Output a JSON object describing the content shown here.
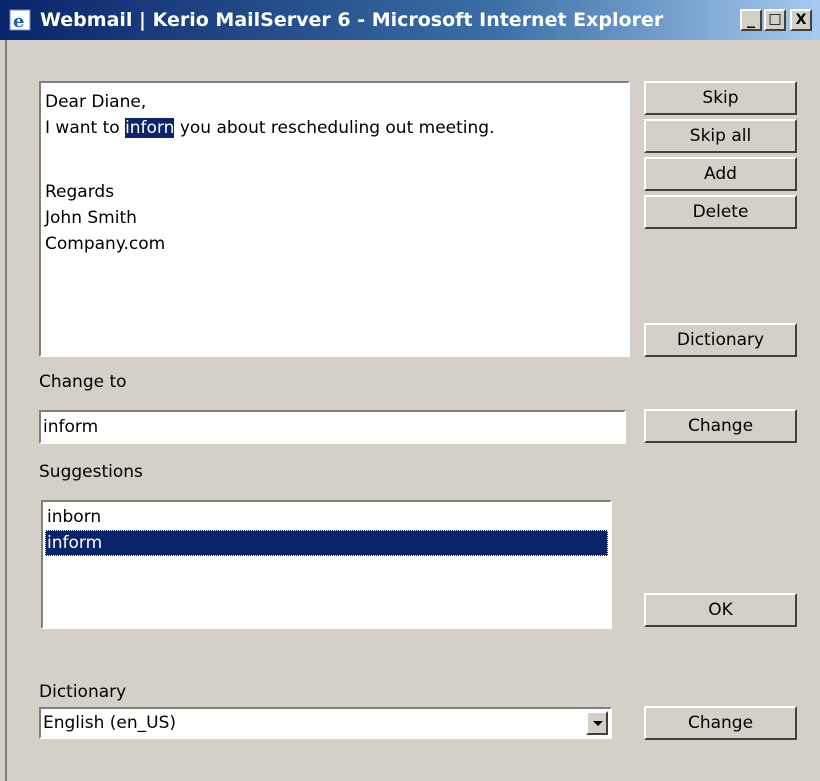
{
  "window": {
    "title": "Webmail | Kerio MailServer 6 - Microsoft Internet Explorer",
    "minimize": "_",
    "maximize": "□",
    "close": "X"
  },
  "message": {
    "line1": "Dear Diane,",
    "line2_before": "I want to ",
    "line2_word": "inforn",
    "line2_after": " you about rescheduling out meeting.",
    "line3": "Regards",
    "line4": "John Smith",
    "line5": "Company.com"
  },
  "buttons": {
    "skip": "Skip",
    "skip_all": "Skip all",
    "add": "Add",
    "delete": "Delete",
    "dictionary": "Dictionary",
    "change": "Change",
    "ok": "OK",
    "dict_change": "Change"
  },
  "change_to": {
    "label": "Change to",
    "value": "inform"
  },
  "suggestions": {
    "label": "Suggestions",
    "items": [
      "inborn",
      "inform"
    ],
    "selected_index": 1
  },
  "dictionary": {
    "label": "Dictionary",
    "selected": "English (en_US)"
  }
}
